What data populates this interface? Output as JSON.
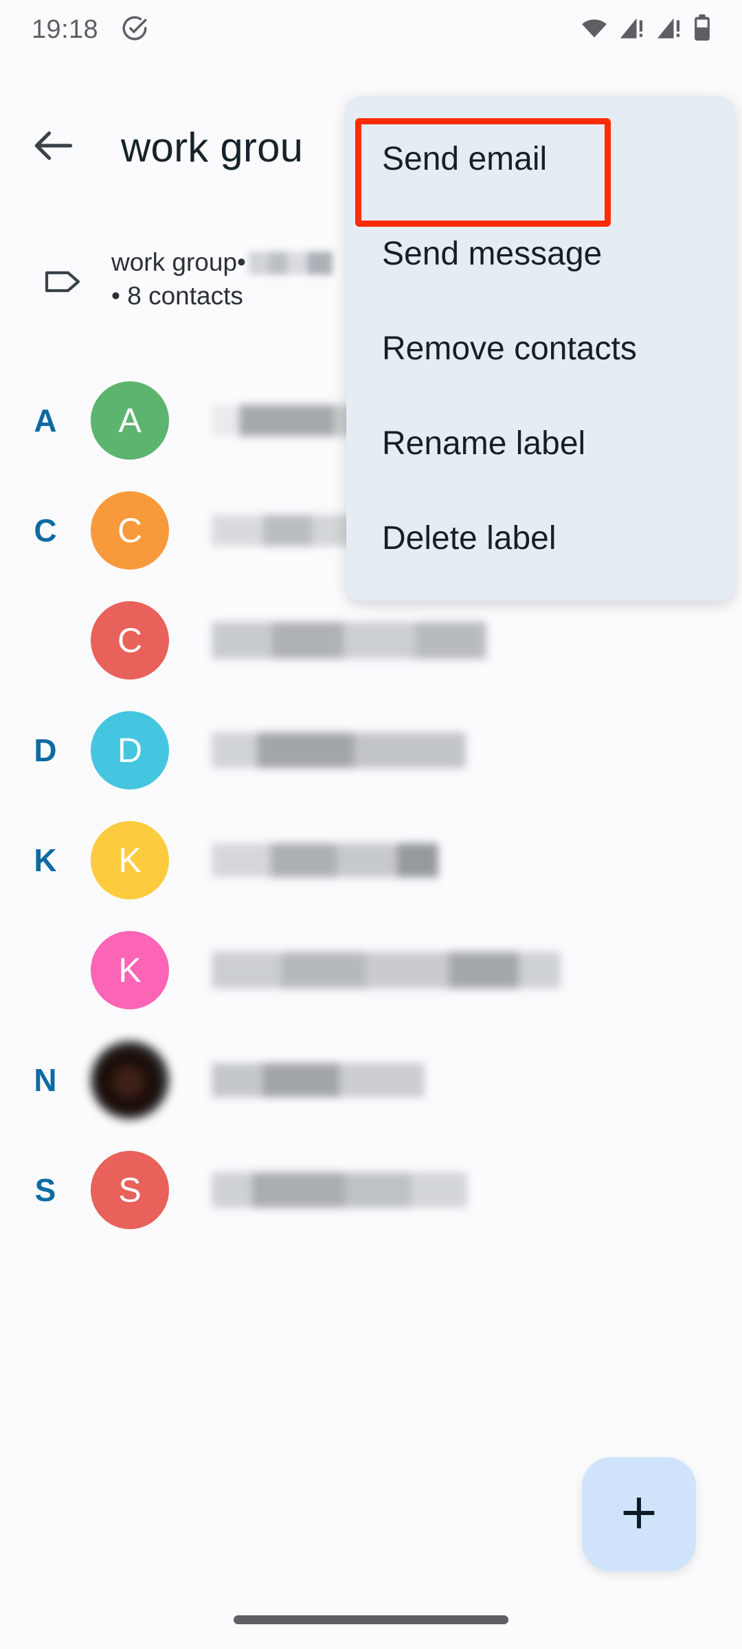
{
  "status_bar": {
    "time": "19:18",
    "left_icons": [
      "check-circle-icon"
    ],
    "right_icons": [
      "wifi-icon",
      "signal-no-sim-icon",
      "signal-no-sim-icon",
      "battery-icon"
    ]
  },
  "app_bar": {
    "back_label": "back-arrow",
    "title": "work grou"
  },
  "label_header": {
    "icon": "label-tag-icon",
    "name": "work group",
    "separator": "•",
    "redacted": "",
    "contacts_count": "• 8 contacts"
  },
  "menu": {
    "items": [
      {
        "label": "Send email",
        "highlighted": true
      },
      {
        "label": "Send message",
        "highlighted": false
      },
      {
        "label": "Remove contacts",
        "highlighted": false
      },
      {
        "label": "Rename label",
        "highlighted": false
      },
      {
        "label": "Delete label",
        "highlighted": false
      }
    ],
    "highlight_color": "#fb2b06",
    "background_color": "#e6ecf3"
  },
  "contacts": [
    {
      "index": "A",
      "initial": "A",
      "avatar_color": "#5cb46e",
      "avatar_type": "initial",
      "name_redacted": true
    },
    {
      "index": "C",
      "initial": "C",
      "avatar_color": "#f89a3c",
      "avatar_type": "initial",
      "name_redacted": true
    },
    {
      "index": "",
      "initial": "C",
      "avatar_color": "#e8615a",
      "avatar_type": "initial",
      "name_redacted": true
    },
    {
      "index": "D",
      "initial": "D",
      "avatar_color": "#45c6e0",
      "avatar_type": "initial",
      "name_redacted": true
    },
    {
      "index": "K",
      "initial": "K",
      "avatar_color": "#fdcb3e",
      "avatar_type": "initial",
      "name_redacted": true
    },
    {
      "index": "",
      "initial": "K",
      "avatar_color": "#fc64b6",
      "avatar_type": "initial",
      "name_redacted": true
    },
    {
      "index": "N",
      "initial": "",
      "avatar_color": "#3d2018",
      "avatar_type": "photo",
      "name_redacted": true
    },
    {
      "index": "S",
      "initial": "S",
      "avatar_color": "#e8615a",
      "avatar_type": "initial",
      "name_redacted": true
    }
  ],
  "fab": {
    "icon": "plus-icon",
    "color": "#cfe4fb"
  },
  "navigation": {
    "gesture_bar": "home-gesture-bar"
  },
  "colors": {
    "background": "#fbfbfd",
    "index_letter": "#0d6ba3",
    "title_text": "#17232b"
  }
}
